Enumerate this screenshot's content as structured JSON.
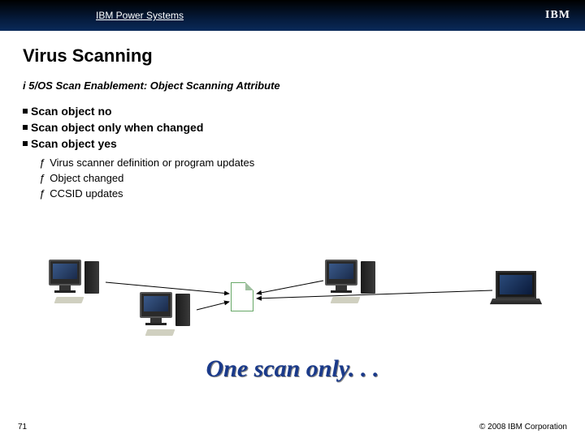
{
  "header": {
    "product_line": "IBM Power Systems",
    "logo_text": "IBM"
  },
  "title": "Virus Scanning",
  "subtitle": "i 5/OS Scan Enablement: Object Scanning Attribute",
  "bullets": [
    "Scan object no",
    "Scan object only when changed",
    "Scan object yes"
  ],
  "sub_bullets": [
    "Virus scanner definition or program updates",
    "Object changed",
    "CCSID updates"
  ],
  "caption": "One scan only. . .",
  "footer": {
    "page_number": "71",
    "copyright": "© 2008 IBM Corporation"
  }
}
